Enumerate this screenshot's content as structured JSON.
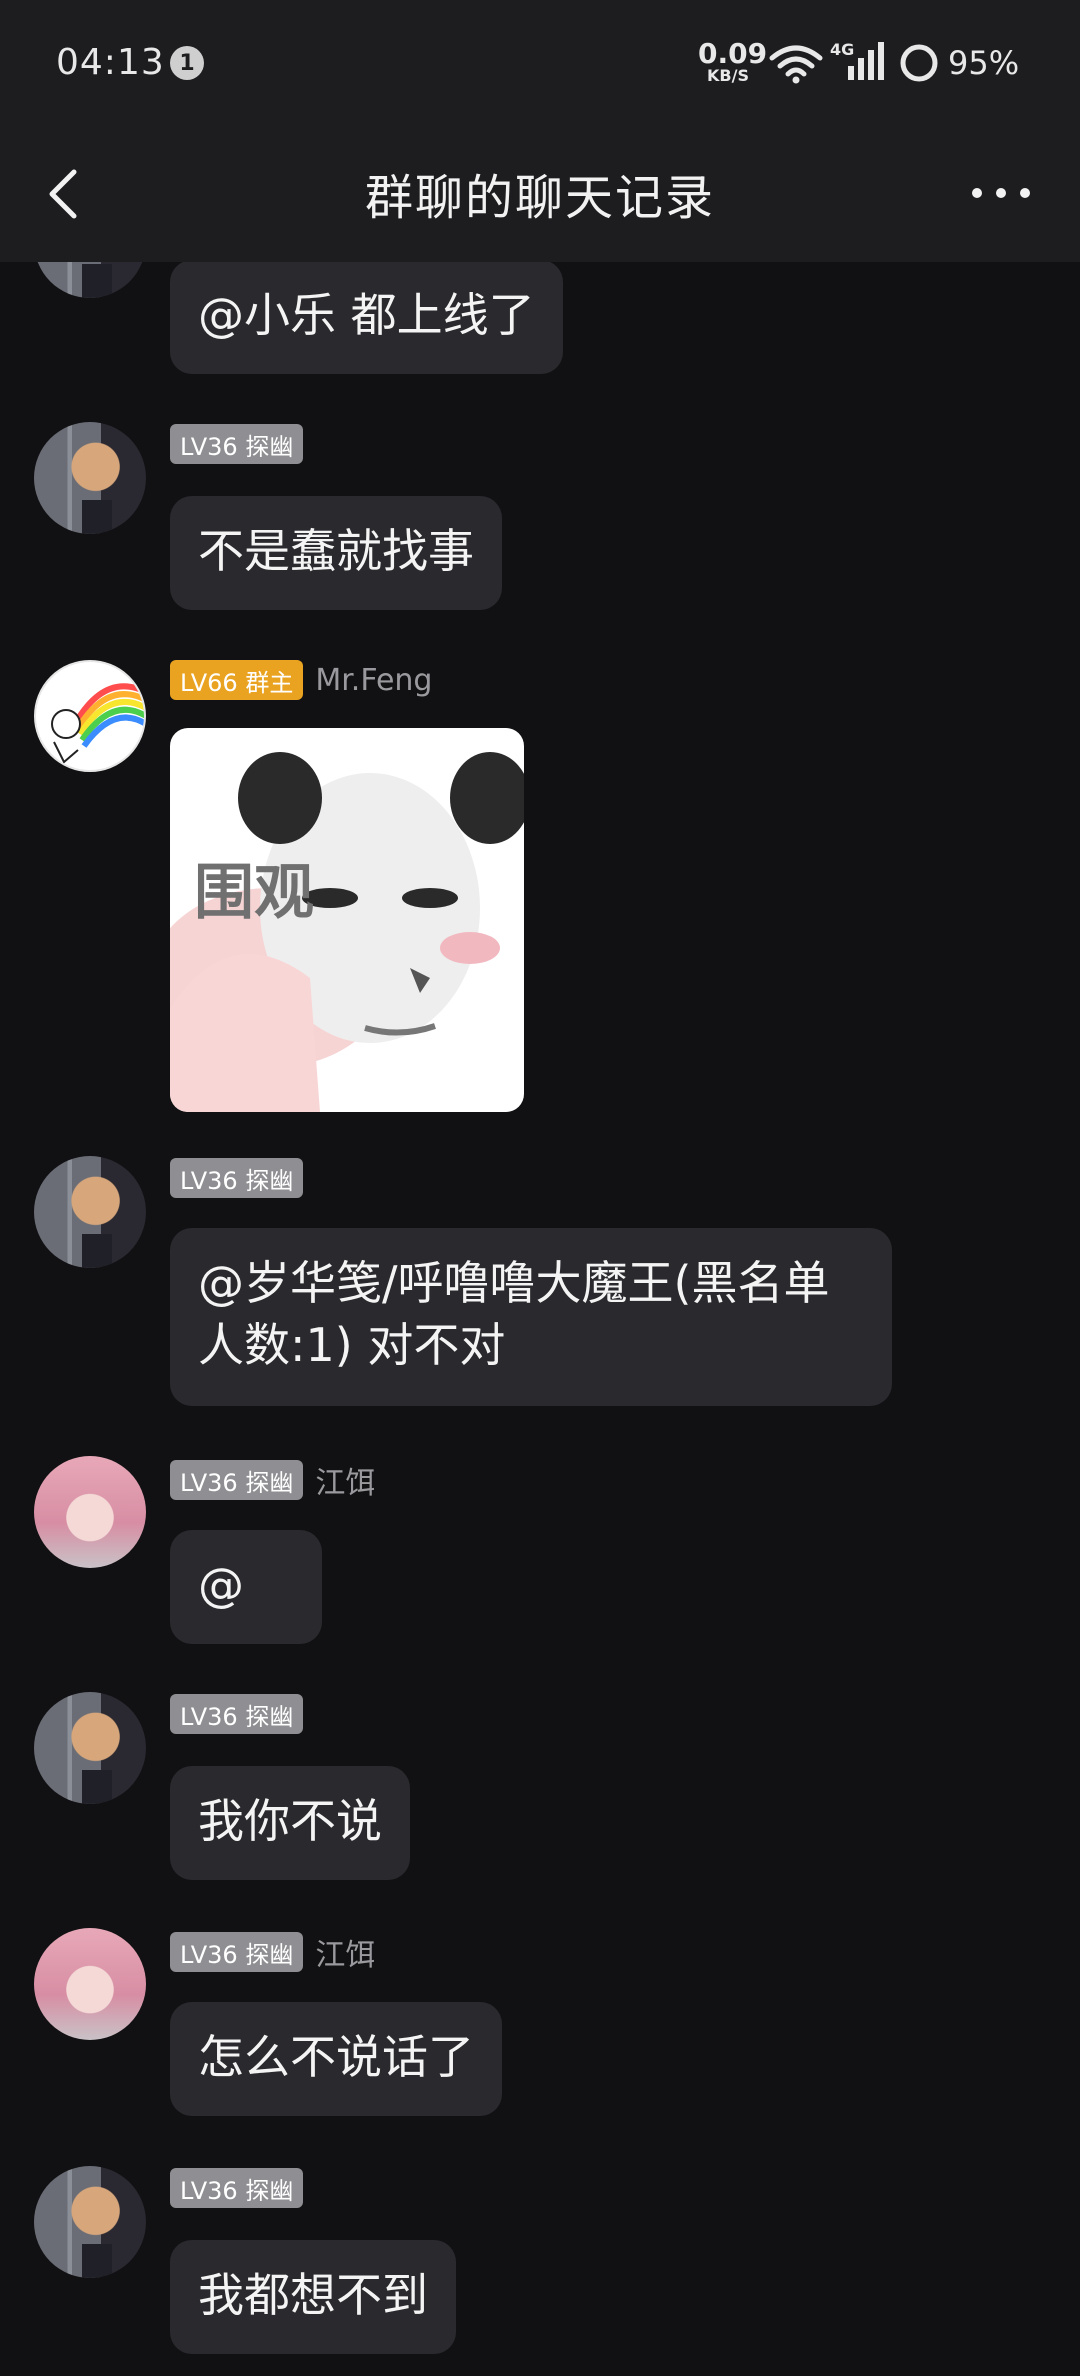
{
  "status_bar": {
    "time": "04:13",
    "notification_count": "1",
    "net_speed_value": "0.09",
    "net_speed_unit": "KB/S",
    "network_type": "4G",
    "battery": "95%"
  },
  "header": {
    "title": "群聊的聊天记录"
  },
  "messages": [
    {
      "text": "@小乐 都上线了"
    },
    {
      "badge": "LV36 探幽",
      "text": "不是蠢就找事"
    },
    {
      "badge": "LV66 群主",
      "name": "Mr.Feng",
      "sticker_text": "围观"
    },
    {
      "badge": "LV36 探幽",
      "text": "@岁华笺/呼噜噜大魔王(黑名单\n人数:1) 对不对"
    },
    {
      "badge": "LV36 探幽",
      "name": "江饵",
      "text": "@"
    },
    {
      "badge": "LV36 探幽",
      "text": "我你不说"
    },
    {
      "badge": "LV36 探幽",
      "name": "江饵",
      "text": "怎么不说话了"
    },
    {
      "badge": "LV36 探幽",
      "text": "我都想不到"
    }
  ],
  "colors": {
    "background": "#111113",
    "bar": "#1d1d20",
    "bubble": "#2a2a2e",
    "badge_gray": "#8f8f93",
    "badge_gold": "#e9a321"
  },
  "icons": [
    "back-arrow-icon",
    "more-dots-icon",
    "wifi-icon",
    "signal-icon",
    "battery-ring-icon"
  ]
}
